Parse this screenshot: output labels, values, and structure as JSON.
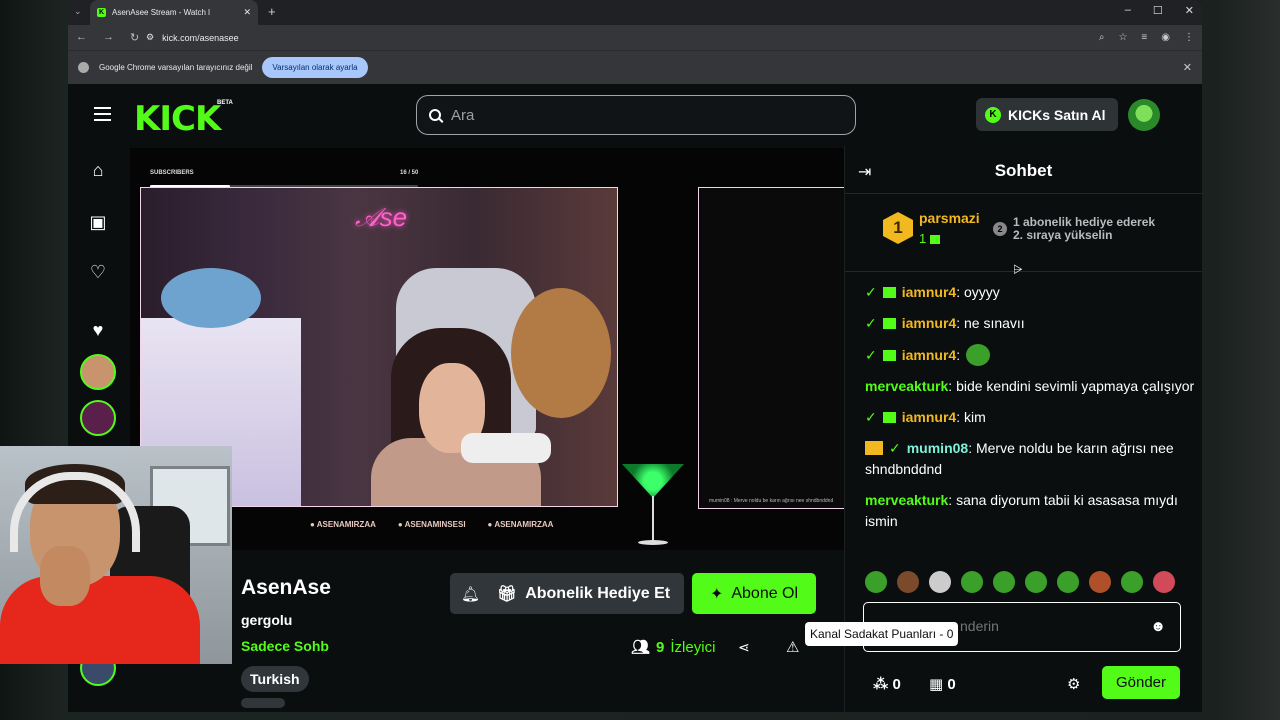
{
  "browser": {
    "tab_title": "AsenAsee Stream - Watch l",
    "url": "kick.com/asenasee",
    "info_text": "Google Chrome varsayılan tarayıcınız değil",
    "info_button": "Varsayılan olarak ayarla"
  },
  "header": {
    "logo": "KICK",
    "beta": "BETA",
    "search_placeholder": "Ara",
    "kicks_button": "KICKs Satın Al"
  },
  "video": {
    "sub_goal_label": "SUBSCRIBERS",
    "sub_goal_count": "16 / 50",
    "sub_goal_progress": 0.3,
    "panel_text": "mumin08 : Merve noldu be karın ağrısı nee shndbnddnd",
    "socials": [
      "ASENAMIRZAA",
      "ASENAMINSESI",
      "ASENAMIRZAA"
    ]
  },
  "stream": {
    "name": "AsenAse",
    "title": "gergolu",
    "category": "Sadece Sohb",
    "tag": "Turkish",
    "gift_button": "Abonelik Hediye Et",
    "subscribe_button": "Abone Ol",
    "viewer_count": "9",
    "viewer_label": "İzleyici"
  },
  "chat": {
    "title": "Sohbet",
    "pinned_user": "parsmazi",
    "pinned_rank": "1",
    "pinned_count": "1",
    "pinned_next_rank": "2",
    "pinned_message_line1": "1 abonelik hediye ederek",
    "pinned_message_line2": "2. sıraya yükselin",
    "messages": [
      {
        "user": "iamnur4",
        "text": "oyyyy",
        "color": "#f2b81f"
      },
      {
        "user": "iamnur4",
        "text": "ne sınavıı",
        "color": "#f2b81f"
      },
      {
        "user": "iamnur4",
        "text": "",
        "color": "#f2b81f"
      },
      {
        "user": "merveakturk",
        "text": "bide kendini sevimli yapmaya çalışıyor",
        "color": "#53fc18"
      },
      {
        "user": "iamnur4",
        "text": "kim",
        "color": "#f2b81f"
      },
      {
        "user": "mumin08",
        "text": "Merve noldu be karın ağrısı nee shndbnddnd",
        "color": "#7ff0d9"
      },
      {
        "user": "merveakturk",
        "text": "sana diyorum tabii ki asasasa mıydı ismin",
        "color": "#53fc18"
      }
    ],
    "input_placeholder": "nderin",
    "tooltip": "Kanal Sadakat Puanları - 0",
    "points": "0",
    "store": "0",
    "send_button": "Gönder"
  }
}
